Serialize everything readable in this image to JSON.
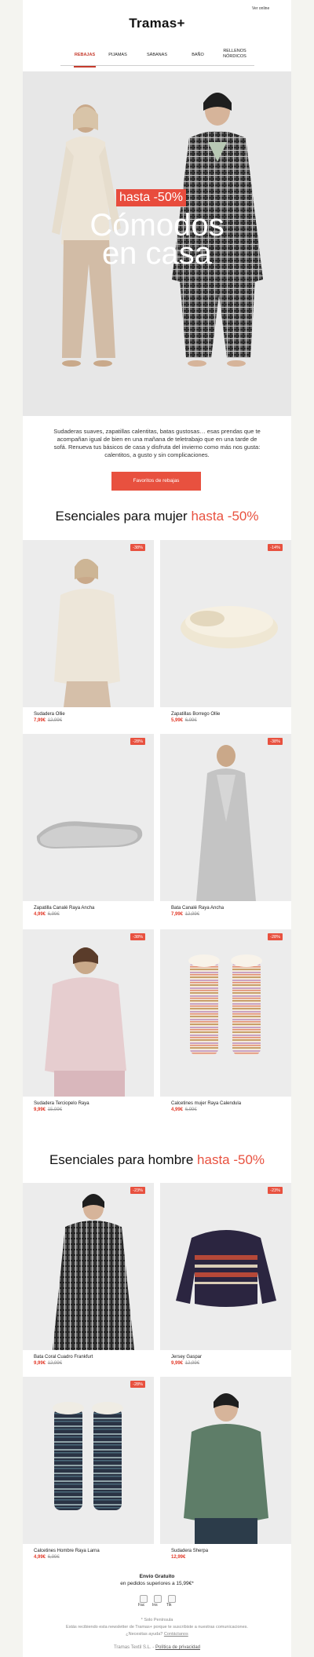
{
  "header": {
    "view_online": "Ver online",
    "logo": "Tramas+"
  },
  "nav": [
    {
      "label": "REBAJAS",
      "active": true
    },
    {
      "label": "PIJAMAS",
      "active": false
    },
    {
      "label": "SÁBANAS",
      "active": false
    },
    {
      "label": "BAÑO",
      "active": false
    },
    {
      "label": "RELLENOS NÓRDICOS",
      "active": false
    }
  ],
  "hero": {
    "badge": "hasta -50%",
    "title_line1": "Cómodos",
    "title_line2": "en casa"
  },
  "intro": {
    "text": "Sudaderas suaves, zapatillas calentitas, batas gustosas… esas prendas que te acompañan igual de bien en una mañana de teletrabajo que en una tarde de sofá. Renueva tus básicos de casa y disfruta del invierno como más nos gusta: calentitos, a gusto y sin complicaciones.",
    "cta": "Favoritos de rebajas"
  },
  "women": {
    "title": "Esenciales para mujer",
    "accent": "hasta -50%",
    "products": [
      {
        "name": "Sudadera Ollie",
        "price": "7,99€",
        "old": "12,99€",
        "badge": "-38%"
      },
      {
        "name": "Zapatillas Borrego Ollie",
        "price": "5,99€",
        "old": "6,99€",
        "badge": "-14%"
      },
      {
        "name": "Zapatilla Canalé Raya Ancha",
        "price": "4,99€",
        "old": "6,99€",
        "badge": "-28%"
      },
      {
        "name": "Bata Canalé Raya Ancha",
        "price": "7,99€",
        "old": "12,99€",
        "badge": "-38%"
      },
      {
        "name": "Sudadera Terciopelo Raya",
        "price": "9,99€",
        "old": "15,99€",
        "badge": "-38%"
      },
      {
        "name": "Calcetines mujer Raya Calendula",
        "price": "4,99€",
        "old": "6,99€",
        "badge": "-28%"
      }
    ]
  },
  "men": {
    "title": "Esenciales para hombre",
    "accent": "hasta -50%",
    "products": [
      {
        "name": "Bata Coral Cuadro Frankfurt",
        "price": "9,99€",
        "old": "12,99€",
        "badge": "-23%"
      },
      {
        "name": "Jersey Gaspar",
        "price": "9,99€",
        "old": "12,99€",
        "badge": "-23%"
      },
      {
        "name": "Calcetines Hombre Raya Larna",
        "price": "4,99€",
        "old": "6,99€",
        "badge": "-28%"
      },
      {
        "name": "Sudadera Sherpa",
        "price": "12,99€",
        "old": "",
        "badge": ""
      }
    ]
  },
  "footer": {
    "free_title": "Envío Gratuito",
    "free_sub": "en pedidos superiores a 15,99€*",
    "social": [
      {
        "label": "Fac",
        "icon": "facebook-icon"
      },
      {
        "label": "Ins",
        "icon": "instagram-icon"
      },
      {
        "label": "Tik",
        "icon": "tiktok-icon"
      }
    ],
    "peninsula": "* Solo Península",
    "newsletter": "Estás recibiendo esta newsletter de Tramas+ porque te suscribiste a nuestras comunicaciones.",
    "help": "¿Necesitas ayuda?",
    "contact": "Contáctanos",
    "company": "Tramas Textil S.L.",
    "separator": " - ",
    "privacy": "Política de privacidad"
  },
  "colors": {
    "accent": "#e8513f",
    "page_bg": "#f4f4f0"
  }
}
